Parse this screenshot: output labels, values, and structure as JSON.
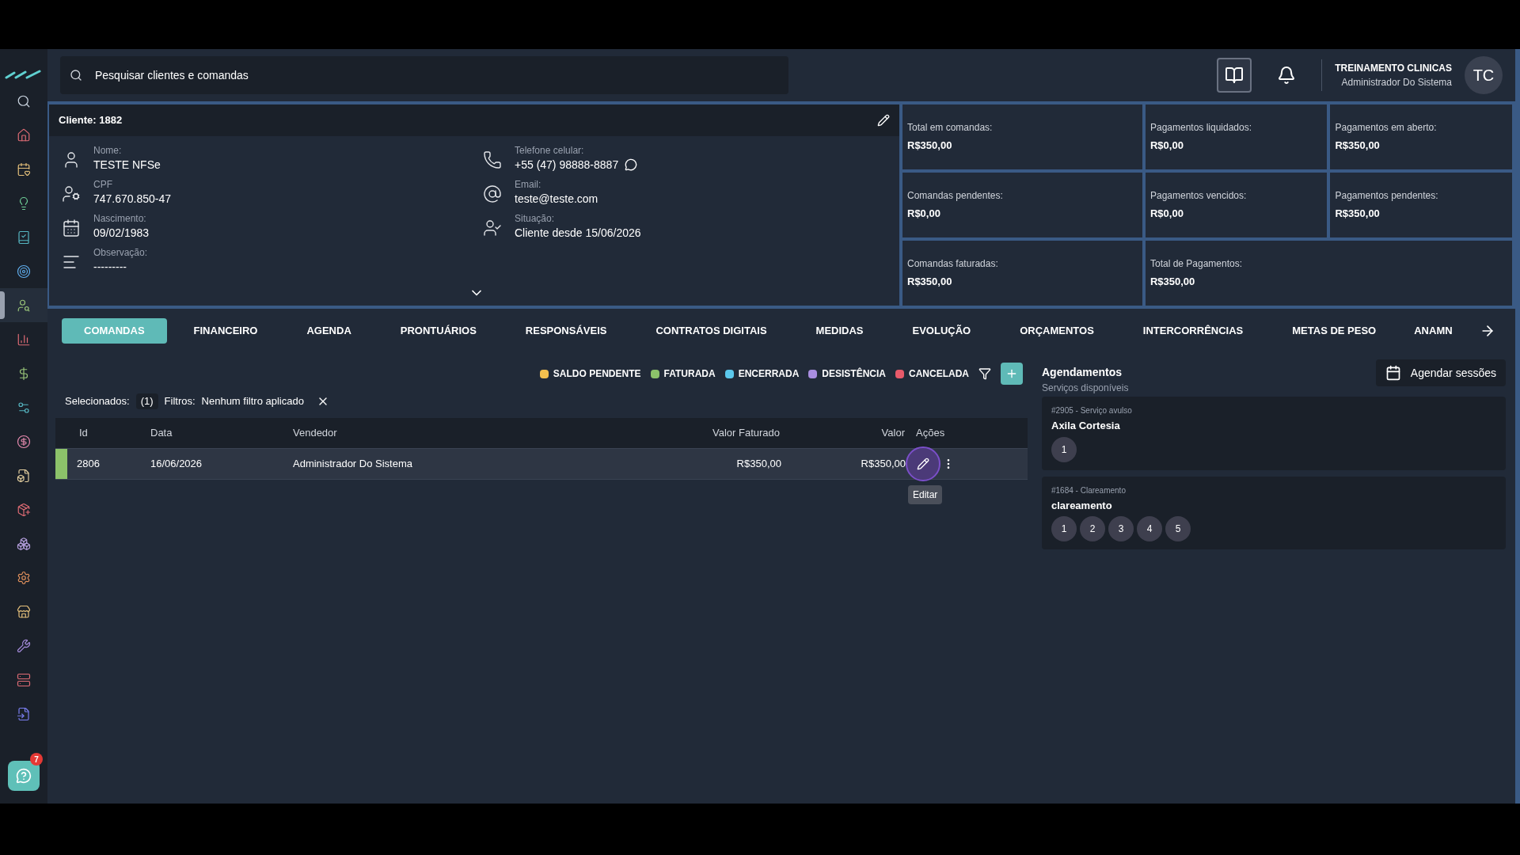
{
  "sidebar": {
    "items": [
      {
        "selected": false
      },
      {
        "selected": false
      },
      {
        "selected": false
      },
      {
        "selected": false
      },
      {
        "selected": false
      },
      {
        "selected": false
      },
      {
        "selected": true
      },
      {
        "selected": false
      },
      {
        "selected": false
      },
      {
        "selected": false
      },
      {
        "selected": false
      },
      {
        "selected": false
      },
      {
        "selected": false
      },
      {
        "selected": false
      },
      {
        "selected": false
      },
      {
        "selected": false
      },
      {
        "selected": false
      },
      {
        "selected": false
      },
      {
        "selected": false
      }
    ],
    "help_badge": "7"
  },
  "header": {
    "search": {
      "placeholder": "Pesquisar clientes e comandas"
    },
    "user": {
      "name": "TREINAMENTO CLINICAS",
      "role": "Administrador Do Sistema",
      "initials": "TC"
    }
  },
  "client": {
    "title": "Cliente: 1882",
    "fields": [
      {
        "label": "Nome:",
        "value": "TESTE NFSe"
      },
      {
        "label": "CPF",
        "value": "747.670.850-47"
      },
      {
        "label": "Nascimento:",
        "value": "09/02/1983"
      },
      {
        "label": "Observação:",
        "value": "---------"
      },
      {
        "label": "Telefone celular:",
        "value": "+55 (47) 98888-8887"
      },
      {
        "label": "Email:",
        "value": "teste@teste.com"
      },
      {
        "label": "Situação:",
        "value": "Cliente desde 15/06/2026"
      }
    ]
  },
  "stats": [
    {
      "label": "Total em comandas:",
      "value": "R$350,00"
    },
    {
      "label": "Pagamentos liquidados:",
      "value": "R$0,00"
    },
    {
      "label": "Pagamentos em aberto:",
      "value": "R$350,00"
    },
    {
      "label": "Comandas pendentes:",
      "value": "R$0,00"
    },
    {
      "label": "Pagamentos vencidos:",
      "value": "R$0,00"
    },
    {
      "label": "Pagamentos pendentes:",
      "value": "R$350,00"
    },
    {
      "label": "Comandas faturadas:",
      "value": "R$350,00"
    },
    {
      "label": "Total de Pagamentos:",
      "value": "R$350,00"
    }
  ],
  "tabs": [
    {
      "label": "COMANDAS",
      "selected": true
    },
    {
      "label": "FINANCEIRO",
      "selected": false
    },
    {
      "label": "AGENDA",
      "selected": false
    },
    {
      "label": "PRONTUÁRIOS",
      "selected": false
    },
    {
      "label": "RESPONSÁVEIS",
      "selected": false
    },
    {
      "label": "CONTRATOS DIGITAIS",
      "selected": false
    },
    {
      "label": "MEDIDAS",
      "selected": false
    },
    {
      "label": "EVOLUÇÃO",
      "selected": false
    },
    {
      "label": "ORÇAMENTOS",
      "selected": false
    },
    {
      "label": "INTERCORRÊNCIAS",
      "selected": false
    },
    {
      "label": "METAS DE PESO",
      "selected": false
    },
    {
      "label": "ANAMN",
      "selected": false
    }
  ],
  "legend": [
    {
      "label": "SALDO PENDENTE",
      "color": "#f4c04e"
    },
    {
      "label": "FATURADA",
      "color": "#8cc26a"
    },
    {
      "label": "ENCERRADA",
      "color": "#5bc8ec"
    },
    {
      "label": "DESISTÊNCIA",
      "color": "#a98de0"
    },
    {
      "label": "CANCELADA",
      "color": "#e85a6a"
    }
  ],
  "selection": {
    "label": "Selecionados:",
    "count": "(1)",
    "filters_label": "Filtros:",
    "filters_value": "Nenhum filtro aplicado"
  },
  "table": {
    "columns": [
      "Id",
      "Data",
      "Vendedor",
      "Valor Faturado",
      "Valor",
      "Ações"
    ],
    "rows": [
      {
        "color": "#8cc26a",
        "cells": [
          "2806",
          "16/06/2026",
          "Administrador Do Sistema",
          "R$350,00",
          "R$350,00"
        ]
      }
    ]
  },
  "tooltip": "Editar",
  "appointments": {
    "title": "Agendamentos",
    "subtitle": "Serviços disponíveis",
    "button": "Agendar sessões",
    "services": [
      {
        "code": "#2905 - Serviço avulso",
        "name": "Axila Cortesia",
        "sessions": [
          "1"
        ]
      },
      {
        "code": "#1684 - Clareamento",
        "name": "clareamento",
        "sessions": [
          "1",
          "2",
          "3",
          "4",
          "5"
        ]
      }
    ]
  }
}
